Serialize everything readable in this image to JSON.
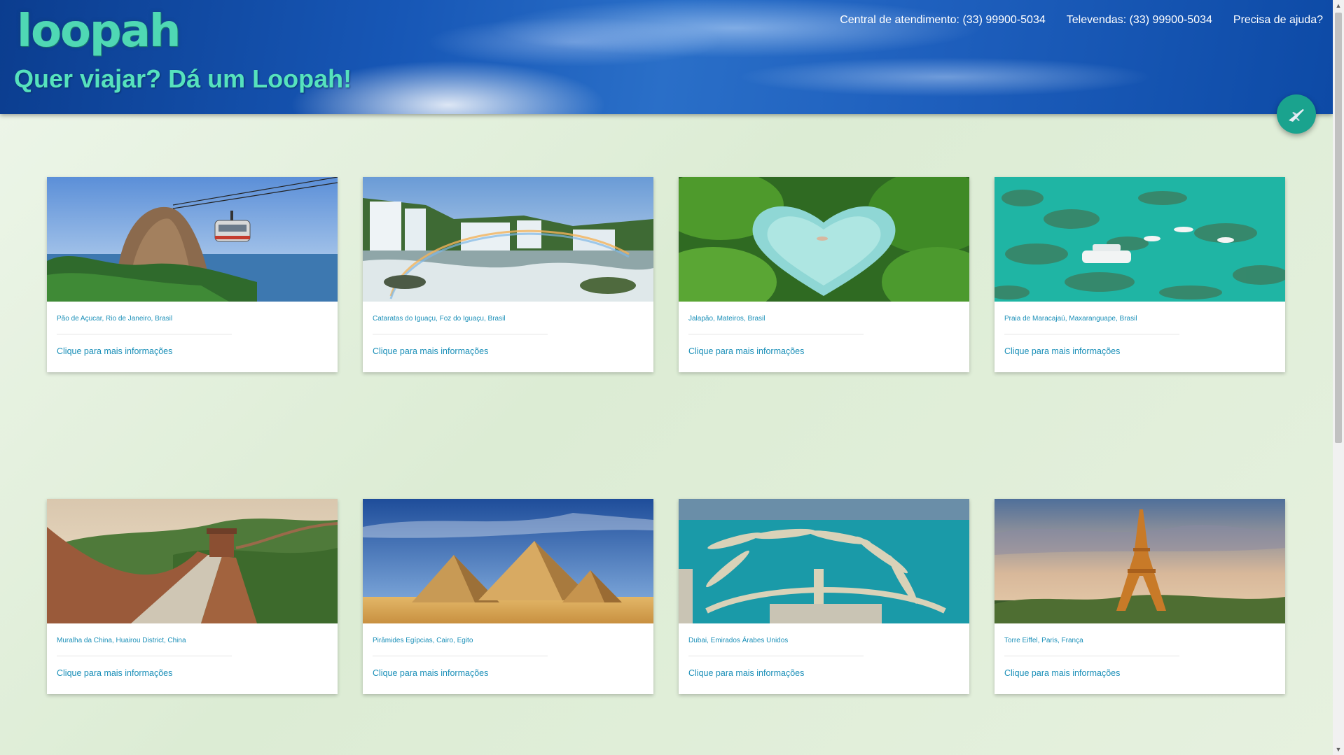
{
  "header": {
    "logo": "loopah",
    "tagline": "Quer viajar? Dá um Loopah!",
    "nav": [
      {
        "label": "Central de atendimento: (33) 99900-5034"
      },
      {
        "label": "Televendas: (33) 99900-5034"
      },
      {
        "label": "Precisa de ajuda?"
      }
    ]
  },
  "fab": {
    "icon": "airplane-icon",
    "color": "#1aa38e"
  },
  "cards": [
    {
      "title": "Pão de Açucar, Rio de Janeiro, Brasil",
      "link": "Clique para mais informações",
      "image": "sugarloaf-mountain"
    },
    {
      "title": "Cataratas do Iguaçu, Foz do Iguaçu, Brasil",
      "link": "Clique para mais informações",
      "image": "iguazu-falls"
    },
    {
      "title": "Jalapão, Mateiros, Brasil",
      "link": "Clique para mais informações",
      "image": "jalapao-pool"
    },
    {
      "title": "Praia de Maracajaú, Maxaranguape, Brasil",
      "link": "Clique para mais informações",
      "image": "maracajau-reef"
    },
    {
      "title": "Muralha da China, Huairou District, China",
      "link": "Clique para mais informações",
      "image": "great-wall"
    },
    {
      "title": "Pirâmides Egípcias, Cairo, Egito",
      "link": "Clique para mais informações",
      "image": "pyramids"
    },
    {
      "title": "Dubai, Emirados Árabes Unidos",
      "link": "Clique para mais informações",
      "image": "palm-jumeirah"
    },
    {
      "title": "Torre Eiffel, Paris, França",
      "link": "Clique para mais informações",
      "image": "eiffel-tower"
    }
  ],
  "colors": {
    "accent": "#1a8fb8",
    "logo": "#4fd8b4",
    "header": "#1757b6",
    "background": "#e1efd9"
  }
}
